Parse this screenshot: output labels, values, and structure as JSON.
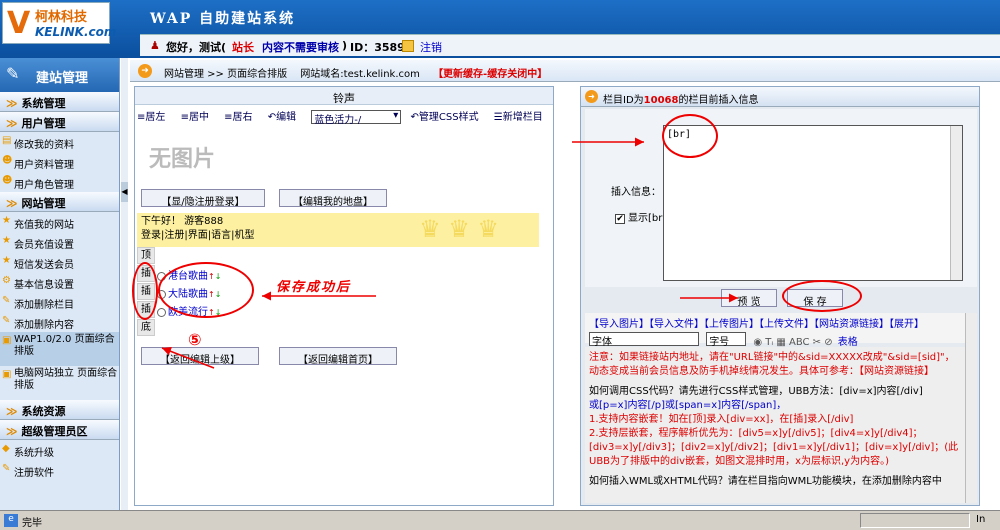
{
  "header": {
    "logo_cn": "柯林科技",
    "logo_en": "KELINK.com",
    "system_title": "WAP 自助建站系统"
  },
  "userbar": {
    "greeting": "您好，测试(",
    "role": "站长",
    "review": "内容不需要审核",
    "closer": ")",
    "id_label": "ID：3589",
    "logout": "注销"
  },
  "sidebar": {
    "header": "建站管理",
    "sections": [
      {
        "label": "系统管理",
        "items": []
      },
      {
        "label": "用户管理",
        "items": [
          "修改我的资料",
          "用户资料管理",
          "用户角色管理"
        ]
      },
      {
        "label": "网站管理",
        "items": [
          "充值我的网站",
          "会员充值设置",
          "短信发送会员",
          "基本信息设置",
          "添加删除栏目",
          "添加删除内容"
        ]
      },
      {
        "label": "系统资源",
        "items": []
      },
      {
        "label": "超级管理员区",
        "items": [
          "系统升级",
          "注册软件"
        ]
      }
    ],
    "wap_item": "WAP1.0/2.0 页面综合排版",
    "pc_item": "电脑网站独立 页面综合排版"
  },
  "breadcrumb": {
    "path": "网站管理 >> 页面综合排版",
    "domain": "网站域名:test.kelink.com",
    "notice": "【更新缓存-缓存关闭中】"
  },
  "left_panel": {
    "title": "铃声",
    "toolbar": [
      "居左",
      "居中",
      "居右",
      "编辑",
      "管理CSS样式",
      "新增栏目"
    ],
    "theme_select": "蓝色活力-/",
    "no_image": "无图片",
    "btn_toggle_login": "【显/隐注册登录】",
    "btn_edit_map": "【编辑我的地盘】",
    "greeting_line": "下午好！ 游客888",
    "links_line": "登录|注册|界面|语言|机型",
    "side_top": "顶",
    "side_insert": "插",
    "side_bottom": "底",
    "songs": [
      "港台歌曲",
      "大陆歌曲",
      "欧美流行"
    ],
    "btn_back_up": "【返回编辑上级】",
    "btn_back_home": "【返回编辑首页】"
  },
  "annotations": {
    "saved": "保存成功后",
    "n5": "⑤",
    "n6": "⑥",
    "n7": "⑦"
  },
  "right_panel": {
    "title_pre": "栏目ID为",
    "title_id": "10068",
    "title_post": "的栏目前插入信息",
    "insert_label": "插入信息：",
    "textarea_value": "[br]",
    "show_br_label": "显示[br]",
    "preview_btn": "预 览",
    "save_btn": "保 存",
    "upload_links": [
      "【导入图片】",
      "【导入文件】",
      "【上传图片】",
      "【上传文件】",
      "【网站资源链接】",
      "【展开】"
    ],
    "font_select": "字体",
    "size_select": "字号",
    "table_label": "表格",
    "notice": "注意：如果链接站内地址，请在\"URL链接\"中的&sid=XXXXX改成\"&sid=[sid]\"，动态变成当前会员信息及防手机掉线情况发生。具体可参考：【网站资源链接】",
    "css_intro": "如何调用CSS代码？请先进行CSS样式管理，UBB方法：[div=x]内容[/div]",
    "css_intro2": "或[p=x]内容[/p]或[span=x]内容[/span]，",
    "css_rule1": "1.支持内容嵌套！如在[顶]录入[div=xx]，在[插]录入[/div]",
    "css_rule2": "2.支持层嵌套，程序解析优先为：[div5=x]y[/div5]；[div4=x]y[/div4]；[div3=x]y[/div3]；[div2=x]y[/div2]；[div1=x]y[/div1]；[div=x]y[/div]；(此UBB为了排版中的div嵌套，如图文混排时用，x为层标识,y为内容。)",
    "css_more": "如何插入WML或XHTML代码？请在栏目指向WML功能模块，在添加删除内容中"
  },
  "statusbar": {
    "text": "完毕",
    "zone": "In"
  }
}
